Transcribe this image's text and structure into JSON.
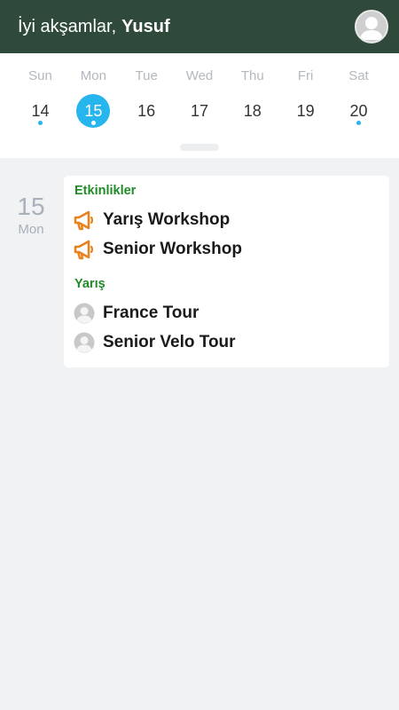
{
  "header": {
    "greeting": "İyi akşamlar,",
    "user_name": "Yusuf",
    "avatar_icon": "user-avatar-icon"
  },
  "calendar": {
    "days": [
      {
        "dow": "Sun",
        "num": "14",
        "selected": false,
        "has_event": true
      },
      {
        "dow": "Mon",
        "num": "15",
        "selected": true,
        "has_event": true
      },
      {
        "dow": "Tue",
        "num": "16",
        "selected": false,
        "has_event": false
      },
      {
        "dow": "Wed",
        "num": "17",
        "selected": false,
        "has_event": false
      },
      {
        "dow": "Thu",
        "num": "18",
        "selected": false,
        "has_event": false
      },
      {
        "dow": "Fri",
        "num": "19",
        "selected": false,
        "has_event": false
      },
      {
        "dow": "Sat",
        "num": "20",
        "selected": false,
        "has_event": true
      }
    ]
  },
  "agenda": {
    "date_num": "15",
    "date_dow": "Mon",
    "sections": [
      {
        "title": "Etkinlikler",
        "items": [
          {
            "label": "Yarış Workshop",
            "icon": "megaphone-icon"
          },
          {
            "label": "Senior Workshop",
            "icon": "megaphone-icon"
          }
        ]
      },
      {
        "title": "Yarış",
        "items": [
          {
            "label": "France Tour",
            "icon": "person-avatar-icon"
          },
          {
            "label": "Senior Velo Tour",
            "icon": "person-avatar-icon"
          }
        ]
      }
    ]
  },
  "colors": {
    "header_bg": "#2f4a3b",
    "accent": "#27b5ee",
    "section_title": "#1f8a26",
    "megaphone": "#e8821e"
  }
}
